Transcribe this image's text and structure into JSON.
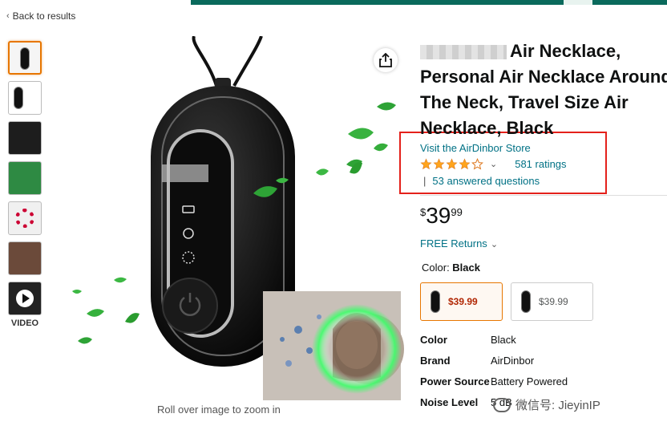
{
  "nav": {
    "back_label": "Back to results"
  },
  "thumbnails": {
    "video_label": "VIDEO"
  },
  "image": {
    "zoom_hint": "Roll over image to zoom in"
  },
  "product": {
    "title_line1": "Air Necklace,",
    "title_line2": "Personal Air Necklace Around",
    "title_line3": "The Neck, Travel Size Air",
    "title_line4": "Necklace, Black",
    "store_link": "Visit the AirDinbor Store",
    "ratings_count": "581 ratings",
    "answered_questions": "53 answered questions",
    "rating_stars": 4.0,
    "price_symbol": "$",
    "price_whole": "39",
    "price_fraction": "99",
    "free_returns": "FREE Returns",
    "color_label": "Color: ",
    "color_value": "Black",
    "swatches": [
      {
        "price": "$39.99"
      },
      {
        "price": "$39.99"
      }
    ],
    "specs": [
      {
        "key": "Color",
        "value": "Black"
      },
      {
        "key": "Brand",
        "value": "AirDinbor"
      },
      {
        "key": "Power Source",
        "value": "Battery Powered"
      },
      {
        "key": "Noise Level",
        "value": "5 dB"
      }
    ]
  },
  "watermark": {
    "text": "微信号: JieyinIP"
  },
  "colors": {
    "link": "#007185",
    "star": "#ffa41c",
    "highlight_box": "#e4211b",
    "selected_border": "#e77600",
    "price_red": "#b12704"
  }
}
